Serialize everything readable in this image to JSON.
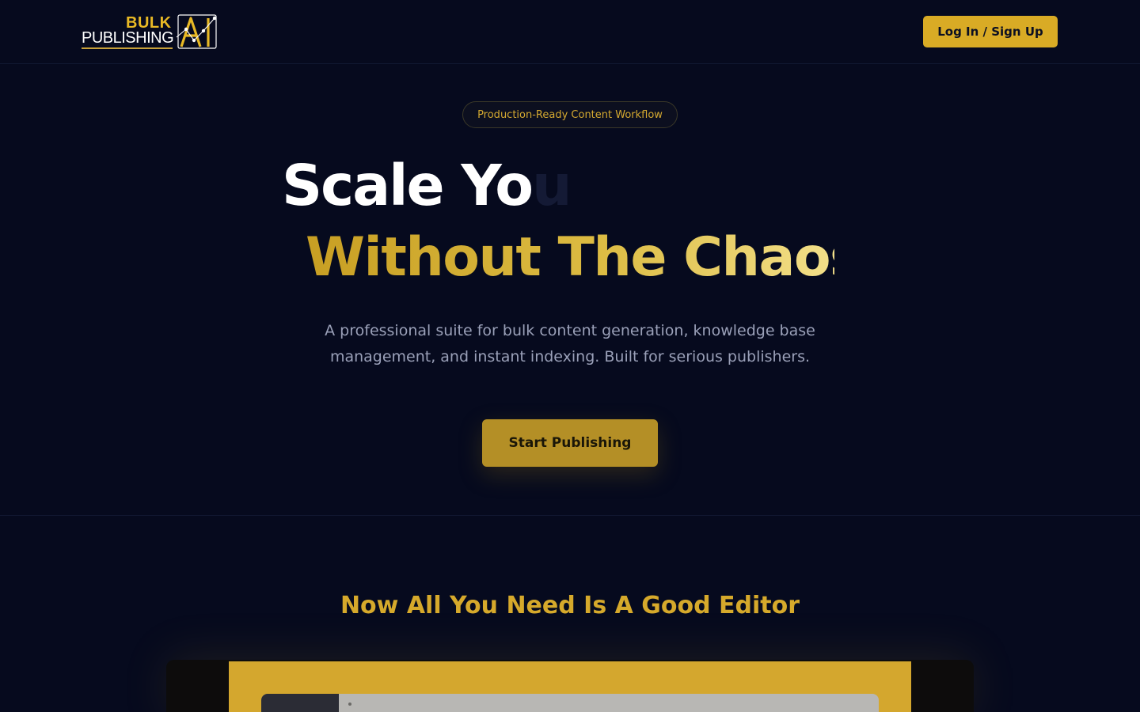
{
  "header": {
    "logo": {
      "word_top": "BULK",
      "word_bottom": "PUBLISHING",
      "mark": "AI"
    },
    "login_label": "Log In / Sign Up"
  },
  "hero": {
    "badge": "Production-Ready Content Workflow",
    "headline_line1_visible": "Scale Yo",
    "headline_line1_faded": "u",
    "headline_line2": "Without The Chaos.",
    "subtitle": "A professional suite for bulk content generation, knowledge base management, and instant indexing. Built for serious publishers.",
    "cta_label": "Start Publishing"
  },
  "section_editor": {
    "title": "Now All You Need Is A Good Editor"
  },
  "colors": {
    "background": "#060a1e",
    "accent_gold": "#d9ab25",
    "text_muted": "#9aa0b8"
  }
}
